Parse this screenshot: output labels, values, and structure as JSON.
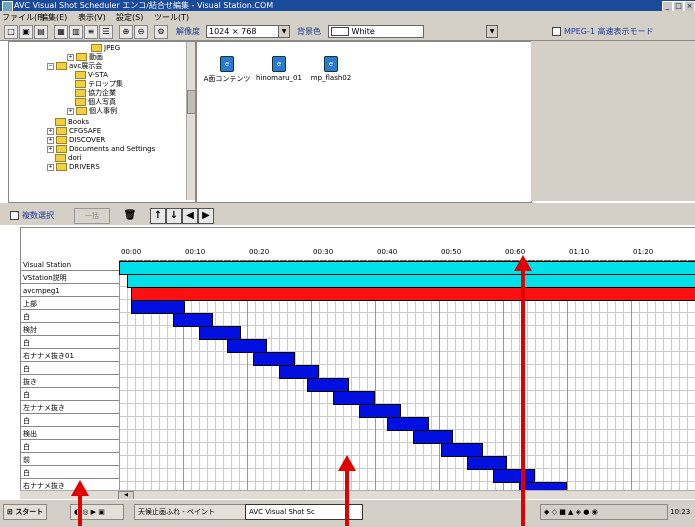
{
  "window": {
    "title": "AVC Visual Shot Scheduler エンコ/結合せ編集 - Visual Station.COM"
  },
  "menu": [
    "ファイル(F)",
    "編集(E)",
    "表示(V)",
    "設定(S)",
    "ツール(T)"
  ],
  "toolbar": {
    "resolution_label": "解像度",
    "resolution_value": "1024 × 768",
    "bg_label": "背景色",
    "bg_value": "White",
    "mpeg_label": "MPEG-1 高速表示モード"
  },
  "tree": [
    "JPEG",
    "動画",
    "avc展示会",
    "V-STA",
    "テロップ集",
    "協力企業",
    "個人写真",
    "個人事例",
    "Books",
    "CFGSAFE",
    "DISCOVER",
    "Documents and Settings",
    "dori",
    "DRIVERS"
  ],
  "files": [
    {
      "name": "A面コンテンツ"
    },
    {
      "name": "hinomaru_01"
    },
    {
      "name": "mp_flash02"
    }
  ],
  "midbar": {
    "multi_select": "複数選択",
    "tx_button": "一括"
  },
  "gantt": {
    "ticks": [
      "00:00",
      "00:10",
      "00:20",
      "00:30",
      "00:40",
      "00:50",
      "00:60",
      "01:10",
      "01:20"
    ],
    "tracks": [
      "Visual Station",
      "VStation説明",
      "avcmpeg1",
      "上部",
      "白",
      "検討",
      "白",
      "右ナナメ抜き01",
      "白",
      "抜き",
      "白",
      "左ナナメ抜き",
      "白",
      "検出",
      "白",
      "前",
      "白",
      "右ナナメ抜き"
    ],
    "colors": {
      "cyan": "#00e0e8",
      "red": "#ff1010",
      "blue": "#0010e0"
    }
  },
  "taskbar": {
    "start": "スタート",
    "tasks": [
      "天候止画ふれ - ペイント",
      "AVC Visual Shot Sc"
    ],
    "clock": "10:23"
  }
}
